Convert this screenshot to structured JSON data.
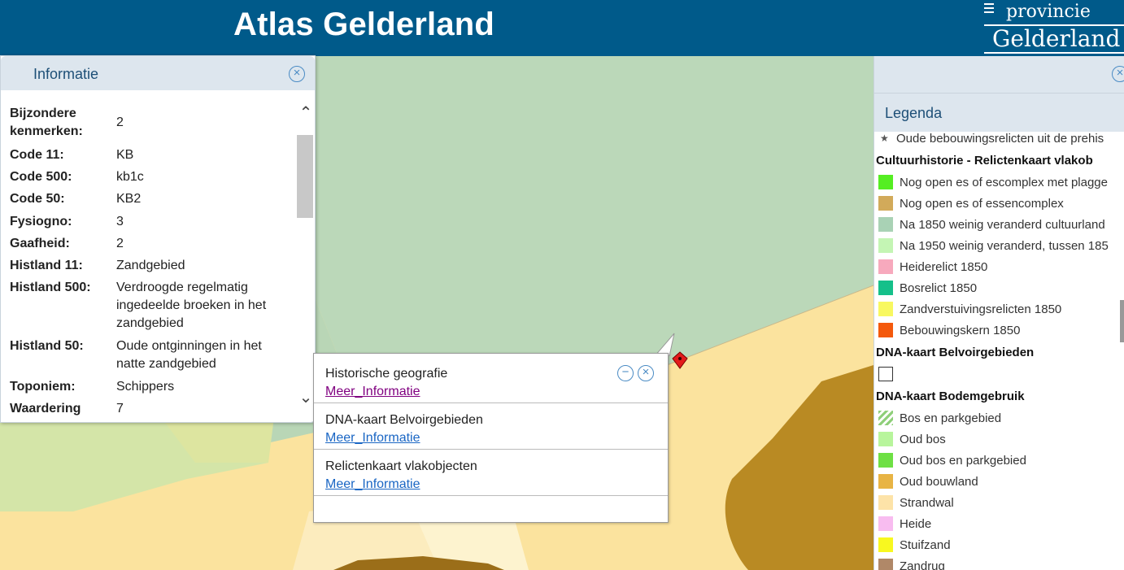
{
  "header": {
    "title": "Atlas Gelderland",
    "logo_line1": "provincie",
    "logo_line2": "Gelderland"
  },
  "info_panel": {
    "title": "Informatie",
    "rows": [
      {
        "key": "Bijzondere kenmerken:",
        "value": "2"
      },
      {
        "key": "Code 11:",
        "value": "KB"
      },
      {
        "key": "Code 500:",
        "value": "kb1c"
      },
      {
        "key": "Code 50:",
        "value": "KB2"
      },
      {
        "key": "Fysiogno:",
        "value": "3"
      },
      {
        "key": "Gaafheid:",
        "value": "2"
      },
      {
        "key": "Histland 11:",
        "value": "Zandgebied"
      },
      {
        "key": "Histland 500:",
        "value": "Verdroogde regelmatig ingedeelde broeken in het zandgebied"
      },
      {
        "key": "Histland 50:",
        "value": "Oude ontginningen in het natte zandgebied"
      },
      {
        "key": "Toponiem:",
        "value": "Schippers"
      },
      {
        "key": "Waardering",
        "value": "7"
      }
    ]
  },
  "popup": {
    "items": [
      {
        "title": "Historische geografie",
        "link": "Meer_Informatie",
        "link_color": "#800080"
      },
      {
        "title": "DNA-kaart Belvoirgebieden",
        "link": "Meer_Informatie",
        "link_color": "#1a66c4"
      },
      {
        "title": "Relictenkaart vlakobjecten",
        "link": "Meer_Informatie",
        "link_color": "#1a66c4"
      }
    ]
  },
  "legend": {
    "title": "Legenda",
    "items": [
      {
        "type": "star",
        "label": "Oude bebouwingsrelicten uit de prehis"
      },
      {
        "type": "header",
        "label": "Cultuurhistorie - Relictenkaart vlakob"
      },
      {
        "type": "swatch",
        "color": "#55ee22",
        "label": "Nog open es of escomplex met plagge"
      },
      {
        "type": "swatch",
        "color": "#d2aa5a",
        "label": "Nog open es of essencomplex"
      },
      {
        "type": "swatch",
        "color": "#a9d2b5",
        "label": "Na 1850 weinig veranderd cultuurland"
      },
      {
        "type": "swatch",
        "color": "#c4f5b4",
        "label": "Na 1950 weinig veranderd, tussen 185"
      },
      {
        "type": "swatch",
        "color": "#f7a9bd",
        "label": "Heiderelict 1850"
      },
      {
        "type": "swatch",
        "color": "#15c08a",
        "label": "Bosrelict 1850"
      },
      {
        "type": "swatch",
        "color": "#f8f860",
        "label": "Zandverstuivingsrelicten 1850"
      },
      {
        "type": "swatch",
        "color": "#f4590c",
        "label": "Bebouwingskern 1850"
      },
      {
        "type": "header",
        "label": "DNA-kaart Belvoirgebieden"
      },
      {
        "type": "outline",
        "label": ""
      },
      {
        "type": "header",
        "label": "DNA-kaart Bodemgebruik"
      },
      {
        "type": "hatch",
        "color": "#8fcf7a",
        "label": "Bos en parkgebied"
      },
      {
        "type": "swatch",
        "color": "#b8f59c",
        "label": "Oud bos"
      },
      {
        "type": "swatch",
        "color": "#6ee044",
        "label": "Oud bos en parkgebied"
      },
      {
        "type": "swatch",
        "color": "#e8b444",
        "label": "Oud bouwland"
      },
      {
        "type": "swatch",
        "color": "#fde3a8",
        "label": "Strandwal"
      },
      {
        "type": "swatch",
        "color": "#f8bcf0",
        "label": "Heide"
      },
      {
        "type": "swatch",
        "color": "#f8f820",
        "label": "Stuifzand"
      },
      {
        "type": "swatch",
        "color": "#b08868",
        "label": "Zandrug"
      }
    ]
  }
}
